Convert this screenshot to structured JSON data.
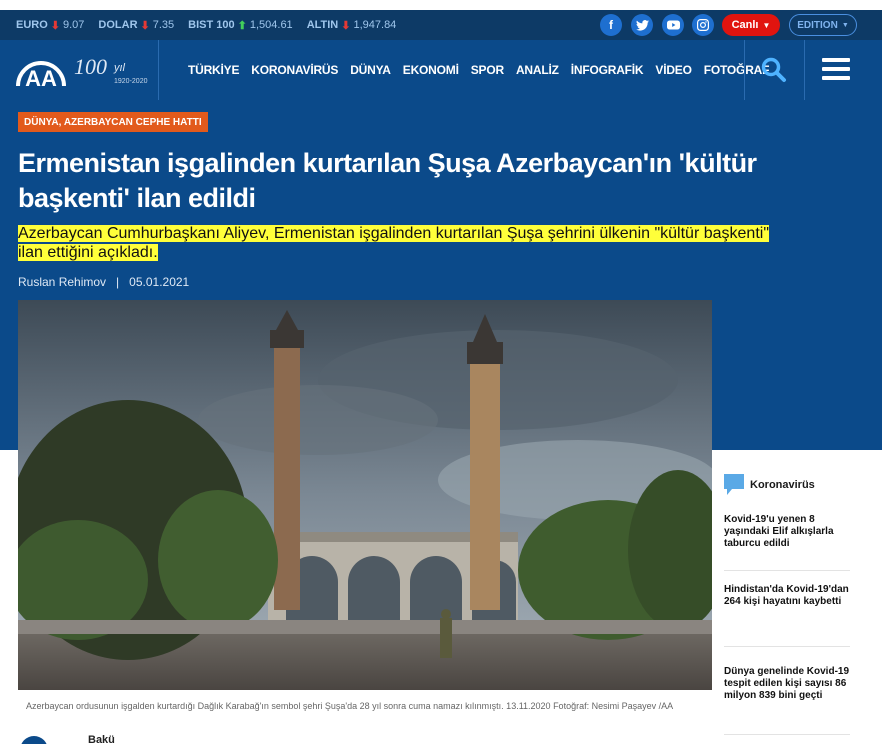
{
  "ticker": [
    {
      "label": "EURO",
      "dir": "down",
      "value": "9.07"
    },
    {
      "label": "DOLAR",
      "dir": "down",
      "value": "7.35"
    },
    {
      "label": "BIST 100",
      "dir": "up",
      "value": "1,504.61"
    },
    {
      "label": "ALTIN",
      "dir": "down",
      "value": "1,947.84"
    }
  ],
  "social_icons": [
    "facebook-icon",
    "twitter-icon",
    "youtube-icon",
    "instagram-icon"
  ],
  "header": {
    "live_label": "Canlı",
    "edition_label": "EDITION",
    "logo_text": "AA",
    "anniv_number": "100",
    "anniv_suffix": "yıl",
    "anniv_years": "1920-2020"
  },
  "nav": [
    "TÜRKİYE",
    "KORONAVİRÜS",
    "DÜNYA",
    "EKONOMİ",
    "SPOR",
    "ANALİZ",
    "İNFOGRAFİK",
    "VİDEO",
    "FOTOĞRAF"
  ],
  "article": {
    "category": "DÜNYA, AZERBAYCAN CEPHE HATTI",
    "title": "Ermenistan işgalinden kurtarılan Şuşa Azerbaycan'ın 'kültür başkenti' ilan edildi",
    "summary": "Azerbaycan Cumhurbaşkanı Aliyev, Ermenistan işgalinden kurtarılan Şuşa şehrini ülkenin \"kültür başkenti\" ilan ettiğini açıkladı.",
    "author": "Ruslan Rehimov",
    "separator": "|",
    "date": "05.01.2021",
    "caption": "Azerbaycan ordusunun işgalden kurtardığı Dağlık Karabağ'ın sembol şehri Şuşa'da 28 yıl sonra cuma namazı kılınmıştı. 13.11.2020 Fotoğraf: Nesimi Paşayev /AA",
    "location": "Bakü"
  },
  "sidebar": {
    "heading": "Koronavirüs",
    "items": [
      "Kovid-19'u yenen 8 yaşındaki Elif alkışlarla taburcu edildi",
      "Hindistan'da Kovid-19'dan 264 kişi hayatını kaybetti",
      "Dünya genelinde Kovid-19 tespit edilen kişi sayısı 86 milyon 839 bini geçti"
    ]
  },
  "colors": {
    "nav_blue": "#0b4a8a",
    "ticker_blue": "#0d3a66",
    "tag_orange": "#e25a1c",
    "live_red": "#e1140f",
    "highlight_yellow": "#ffff3a"
  }
}
